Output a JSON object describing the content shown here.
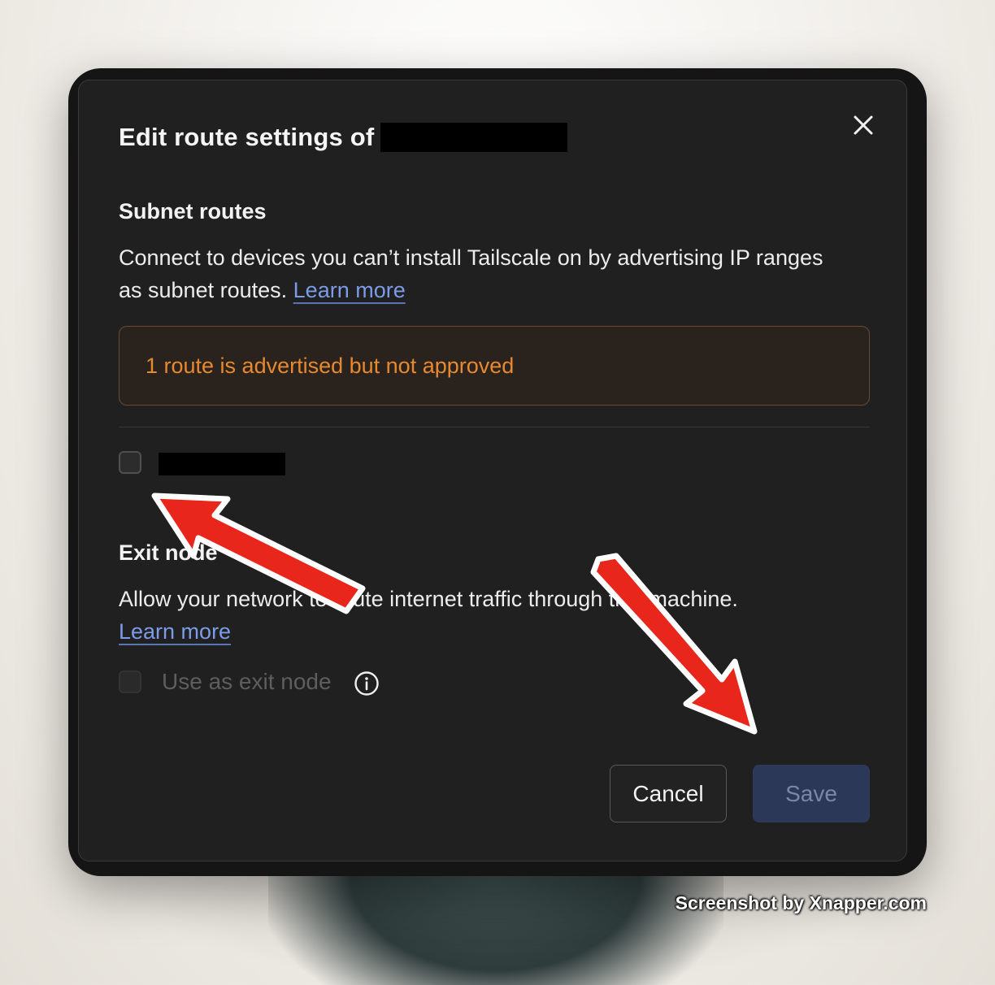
{
  "dialog": {
    "title": "Edit route settings of",
    "close_icon": "close-icon"
  },
  "subnet": {
    "heading": "Subnet routes",
    "description": "Connect to devices you can’t install Tailscale on by advertising IP ranges as subnet routes.",
    "learn_more": "Learn more",
    "warning": "1 route is advertised but not approved"
  },
  "exit_node": {
    "heading": "Exit node",
    "description": "Allow your network to route internet traffic through this machine.",
    "learn_more": "Learn more",
    "checkbox_label": "Use as exit node",
    "info_icon": "info-icon"
  },
  "buttons": {
    "cancel": "Cancel",
    "save": "Save"
  },
  "watermark": "Screenshot by Xnapper.com",
  "colors": {
    "link": "#7c9be8",
    "warning_text": "#e7892f",
    "save_bg": "#2c3858",
    "arrow": "#e8261c"
  }
}
